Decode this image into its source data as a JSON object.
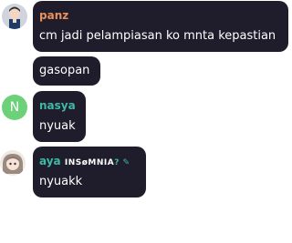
{
  "messages": [
    {
      "author": "panz",
      "author_color": "#e8925a",
      "text": "cm jadi pelampiasan ko mnta kepastian"
    },
    {
      "author": "",
      "text": "gasopan"
    },
    {
      "author": "nasya",
      "author_color": "#3fb8a7",
      "avatar_letter": "N",
      "avatar_color": "#6dd17a",
      "text": "nyuak"
    },
    {
      "author": "aya",
      "author_badge": "INSøMNIA",
      "author_suffix": "? ✎",
      "author_color": "#3fb8a7",
      "text": "nyuakk"
    }
  ],
  "colors": {
    "bubble": "#1f1d2b",
    "text": "#ffffff"
  }
}
